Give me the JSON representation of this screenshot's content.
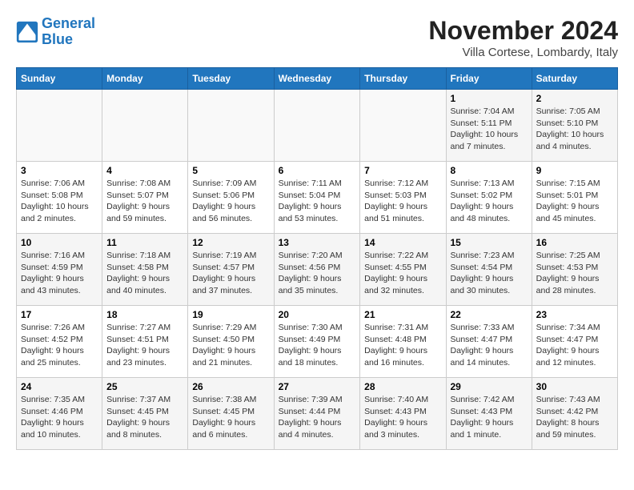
{
  "logo": {
    "line1": "General",
    "line2": "Blue"
  },
  "title": "November 2024",
  "location": "Villa Cortese, Lombardy, Italy",
  "weekdays": [
    "Sunday",
    "Monday",
    "Tuesday",
    "Wednesday",
    "Thursday",
    "Friday",
    "Saturday"
  ],
  "weeks": [
    [
      {
        "day": "",
        "info": ""
      },
      {
        "day": "",
        "info": ""
      },
      {
        "day": "",
        "info": ""
      },
      {
        "day": "",
        "info": ""
      },
      {
        "day": "",
        "info": ""
      },
      {
        "day": "1",
        "info": "Sunrise: 7:04 AM\nSunset: 5:11 PM\nDaylight: 10 hours and 7 minutes."
      },
      {
        "day": "2",
        "info": "Sunrise: 7:05 AM\nSunset: 5:10 PM\nDaylight: 10 hours and 4 minutes."
      }
    ],
    [
      {
        "day": "3",
        "info": "Sunrise: 7:06 AM\nSunset: 5:08 PM\nDaylight: 10 hours and 2 minutes."
      },
      {
        "day": "4",
        "info": "Sunrise: 7:08 AM\nSunset: 5:07 PM\nDaylight: 9 hours and 59 minutes."
      },
      {
        "day": "5",
        "info": "Sunrise: 7:09 AM\nSunset: 5:06 PM\nDaylight: 9 hours and 56 minutes."
      },
      {
        "day": "6",
        "info": "Sunrise: 7:11 AM\nSunset: 5:04 PM\nDaylight: 9 hours and 53 minutes."
      },
      {
        "day": "7",
        "info": "Sunrise: 7:12 AM\nSunset: 5:03 PM\nDaylight: 9 hours and 51 minutes."
      },
      {
        "day": "8",
        "info": "Sunrise: 7:13 AM\nSunset: 5:02 PM\nDaylight: 9 hours and 48 minutes."
      },
      {
        "day": "9",
        "info": "Sunrise: 7:15 AM\nSunset: 5:01 PM\nDaylight: 9 hours and 45 minutes."
      }
    ],
    [
      {
        "day": "10",
        "info": "Sunrise: 7:16 AM\nSunset: 4:59 PM\nDaylight: 9 hours and 43 minutes."
      },
      {
        "day": "11",
        "info": "Sunrise: 7:18 AM\nSunset: 4:58 PM\nDaylight: 9 hours and 40 minutes."
      },
      {
        "day": "12",
        "info": "Sunrise: 7:19 AM\nSunset: 4:57 PM\nDaylight: 9 hours and 37 minutes."
      },
      {
        "day": "13",
        "info": "Sunrise: 7:20 AM\nSunset: 4:56 PM\nDaylight: 9 hours and 35 minutes."
      },
      {
        "day": "14",
        "info": "Sunrise: 7:22 AM\nSunset: 4:55 PM\nDaylight: 9 hours and 32 minutes."
      },
      {
        "day": "15",
        "info": "Sunrise: 7:23 AM\nSunset: 4:54 PM\nDaylight: 9 hours and 30 minutes."
      },
      {
        "day": "16",
        "info": "Sunrise: 7:25 AM\nSunset: 4:53 PM\nDaylight: 9 hours and 28 minutes."
      }
    ],
    [
      {
        "day": "17",
        "info": "Sunrise: 7:26 AM\nSunset: 4:52 PM\nDaylight: 9 hours and 25 minutes."
      },
      {
        "day": "18",
        "info": "Sunrise: 7:27 AM\nSunset: 4:51 PM\nDaylight: 9 hours and 23 minutes."
      },
      {
        "day": "19",
        "info": "Sunrise: 7:29 AM\nSunset: 4:50 PM\nDaylight: 9 hours and 21 minutes."
      },
      {
        "day": "20",
        "info": "Sunrise: 7:30 AM\nSunset: 4:49 PM\nDaylight: 9 hours and 18 minutes."
      },
      {
        "day": "21",
        "info": "Sunrise: 7:31 AM\nSunset: 4:48 PM\nDaylight: 9 hours and 16 minutes."
      },
      {
        "day": "22",
        "info": "Sunrise: 7:33 AM\nSunset: 4:47 PM\nDaylight: 9 hours and 14 minutes."
      },
      {
        "day": "23",
        "info": "Sunrise: 7:34 AM\nSunset: 4:47 PM\nDaylight: 9 hours and 12 minutes."
      }
    ],
    [
      {
        "day": "24",
        "info": "Sunrise: 7:35 AM\nSunset: 4:46 PM\nDaylight: 9 hours and 10 minutes."
      },
      {
        "day": "25",
        "info": "Sunrise: 7:37 AM\nSunset: 4:45 PM\nDaylight: 9 hours and 8 minutes."
      },
      {
        "day": "26",
        "info": "Sunrise: 7:38 AM\nSunset: 4:45 PM\nDaylight: 9 hours and 6 minutes."
      },
      {
        "day": "27",
        "info": "Sunrise: 7:39 AM\nSunset: 4:44 PM\nDaylight: 9 hours and 4 minutes."
      },
      {
        "day": "28",
        "info": "Sunrise: 7:40 AM\nSunset: 4:43 PM\nDaylight: 9 hours and 3 minutes."
      },
      {
        "day": "29",
        "info": "Sunrise: 7:42 AM\nSunset: 4:43 PM\nDaylight: 9 hours and 1 minute."
      },
      {
        "day": "30",
        "info": "Sunrise: 7:43 AM\nSunset: 4:42 PM\nDaylight: 8 hours and 59 minutes."
      }
    ]
  ]
}
